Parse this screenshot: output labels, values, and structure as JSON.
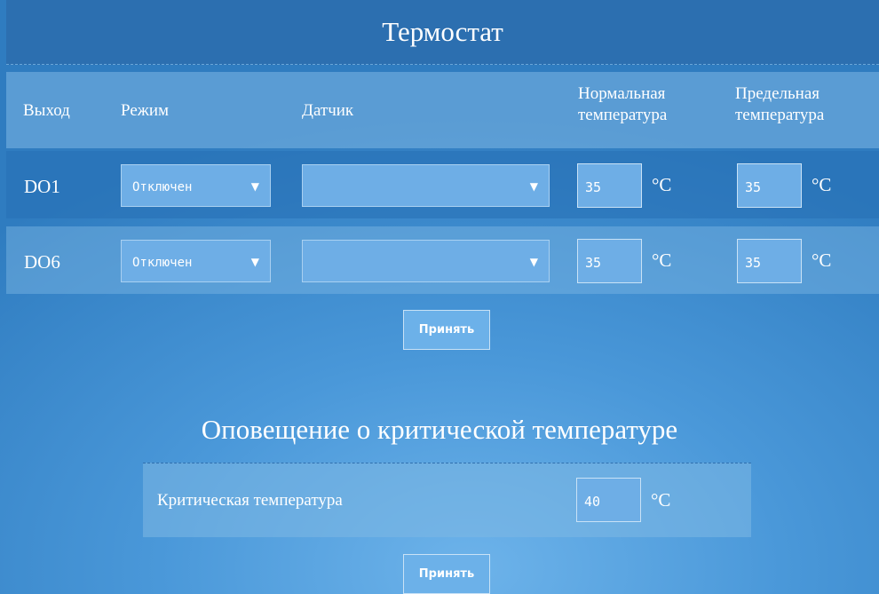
{
  "thermostat": {
    "title": "Термостат",
    "columns": {
      "output": "Выход",
      "mode": "Режим",
      "sensor": "Датчик",
      "normal_line1": "Нормальная",
      "normal_line2": "температура",
      "limit_line1": "Предельная",
      "limit_line2": "температура"
    },
    "rows": [
      {
        "output": "DO1",
        "mode": "Отключен",
        "sensor": "",
        "normal_temp": "35",
        "normal_unit": "°C",
        "limit_temp": "35",
        "limit_unit": "°C"
      },
      {
        "output": "DO6",
        "mode": "Отключен",
        "sensor": "",
        "normal_temp": "35",
        "normal_unit": "°C",
        "limit_temp": "35",
        "limit_unit": "°C"
      }
    ],
    "apply_label": "Принять"
  },
  "alert": {
    "title": "Оповещение о критической температуре",
    "critical_label": "Критическая температура",
    "critical_temp": "40",
    "critical_unit": "°C",
    "apply_label": "Принять"
  },
  "icons": {
    "dropdown": "dropdown-arrow-icon"
  }
}
